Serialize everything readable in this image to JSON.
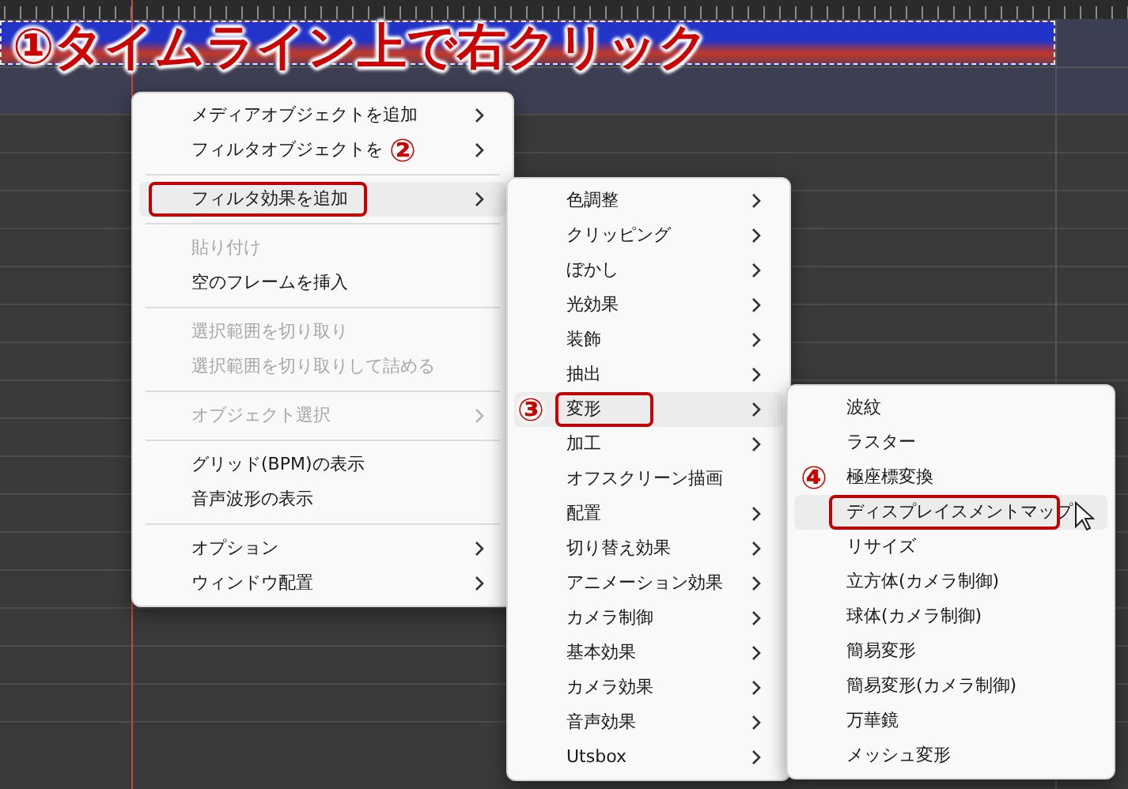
{
  "annotation_title": "①タイムライン上で右クリック",
  "menus": [
    {
      "items": [
        {
          "kind": "item",
          "label": "メディアオブジェクトを追加",
          "submenu": true,
          "disabled": false,
          "selected": false
        },
        {
          "kind": "item",
          "label": "フィルタオブジェクトを",
          "submenu": true,
          "disabled": false,
          "selected": false,
          "callout": "②"
        },
        {
          "kind": "separator"
        },
        {
          "kind": "item",
          "label": "フィルタ効果を追加",
          "submenu": true,
          "disabled": false,
          "selected": true
        },
        {
          "kind": "separator"
        },
        {
          "kind": "item",
          "label": "貼り付け",
          "submenu": false,
          "disabled": true,
          "selected": false
        },
        {
          "kind": "item",
          "label": "空のフレームを挿入",
          "submenu": false,
          "disabled": false,
          "selected": false
        },
        {
          "kind": "separator"
        },
        {
          "kind": "item",
          "label": "選択範囲を切り取り",
          "submenu": false,
          "disabled": true,
          "selected": false
        },
        {
          "kind": "item",
          "label": "選択範囲を切り取りして詰める",
          "submenu": false,
          "disabled": true,
          "selected": false
        },
        {
          "kind": "separator"
        },
        {
          "kind": "item",
          "label": "オブジェクト選択",
          "submenu": true,
          "disabled": true,
          "selected": false
        },
        {
          "kind": "separator"
        },
        {
          "kind": "item",
          "label": "グリッド(BPM)の表示",
          "submenu": false,
          "disabled": false,
          "selected": false
        },
        {
          "kind": "item",
          "label": "音声波形の表示",
          "submenu": false,
          "disabled": false,
          "selected": false
        },
        {
          "kind": "separator"
        },
        {
          "kind": "item",
          "label": "オプション",
          "submenu": true,
          "disabled": false,
          "selected": false
        },
        {
          "kind": "item",
          "label": "ウィンドウ配置",
          "submenu": true,
          "disabled": false,
          "selected": false
        }
      ]
    },
    {
      "items": [
        {
          "kind": "item",
          "label": "色調整",
          "submenu": true,
          "disabled": false,
          "selected": false
        },
        {
          "kind": "item",
          "label": "クリッピング",
          "submenu": true,
          "disabled": false,
          "selected": false
        },
        {
          "kind": "item",
          "label": "ぼかし",
          "submenu": true,
          "disabled": false,
          "selected": false
        },
        {
          "kind": "item",
          "label": "光効果",
          "submenu": true,
          "disabled": false,
          "selected": false
        },
        {
          "kind": "item",
          "label": "装飾",
          "submenu": true,
          "disabled": false,
          "selected": false
        },
        {
          "kind": "item",
          "label": "抽出",
          "submenu": true,
          "disabled": false,
          "selected": false
        },
        {
          "kind": "item",
          "label": "変形",
          "submenu": true,
          "disabled": false,
          "selected": true,
          "callout": "③"
        },
        {
          "kind": "item",
          "label": "加工",
          "submenu": true,
          "disabled": false,
          "selected": false
        },
        {
          "kind": "item",
          "label": "オフスクリーン描画",
          "submenu": false,
          "disabled": false,
          "selected": false
        },
        {
          "kind": "item",
          "label": "配置",
          "submenu": true,
          "disabled": false,
          "selected": false
        },
        {
          "kind": "item",
          "label": "切り替え効果",
          "submenu": true,
          "disabled": false,
          "selected": false
        },
        {
          "kind": "item",
          "label": "アニメーション効果",
          "submenu": true,
          "disabled": false,
          "selected": false
        },
        {
          "kind": "item",
          "label": "カメラ制御",
          "submenu": true,
          "disabled": false,
          "selected": false
        },
        {
          "kind": "item",
          "label": "基本効果",
          "submenu": true,
          "disabled": false,
          "selected": false
        },
        {
          "kind": "item",
          "label": "カメラ効果",
          "submenu": true,
          "disabled": false,
          "selected": false
        },
        {
          "kind": "item",
          "label": "音声効果",
          "submenu": true,
          "disabled": false,
          "selected": false
        },
        {
          "kind": "item",
          "label": "Utsbox",
          "submenu": true,
          "disabled": false,
          "selected": false
        }
      ]
    },
    {
      "items": [
        {
          "kind": "item",
          "label": "波紋",
          "submenu": false,
          "disabled": false,
          "selected": false
        },
        {
          "kind": "item",
          "label": "ラスター",
          "submenu": false,
          "disabled": false,
          "selected": false
        },
        {
          "kind": "item",
          "label": "極座標変換",
          "submenu": false,
          "disabled": false,
          "selected": false,
          "callout": "④"
        },
        {
          "kind": "item",
          "label": "ディスプレイスメントマップ",
          "submenu": false,
          "disabled": false,
          "selected": true
        },
        {
          "kind": "item",
          "label": "リサイズ",
          "submenu": false,
          "disabled": false,
          "selected": false
        },
        {
          "kind": "item",
          "label": "立方体(カメラ制御)",
          "submenu": false,
          "disabled": false,
          "selected": false
        },
        {
          "kind": "item",
          "label": "球体(カメラ制御)",
          "submenu": false,
          "disabled": false,
          "selected": false
        },
        {
          "kind": "item",
          "label": "簡易変形",
          "submenu": false,
          "disabled": false,
          "selected": false
        },
        {
          "kind": "item",
          "label": "簡易変形(カメラ制御)",
          "submenu": false,
          "disabled": false,
          "selected": false
        },
        {
          "kind": "item",
          "label": "万華鏡",
          "submenu": false,
          "disabled": false,
          "selected": false
        },
        {
          "kind": "item",
          "label": "メッシュ変形",
          "submenu": false,
          "disabled": false,
          "selected": false
        }
      ]
    }
  ]
}
